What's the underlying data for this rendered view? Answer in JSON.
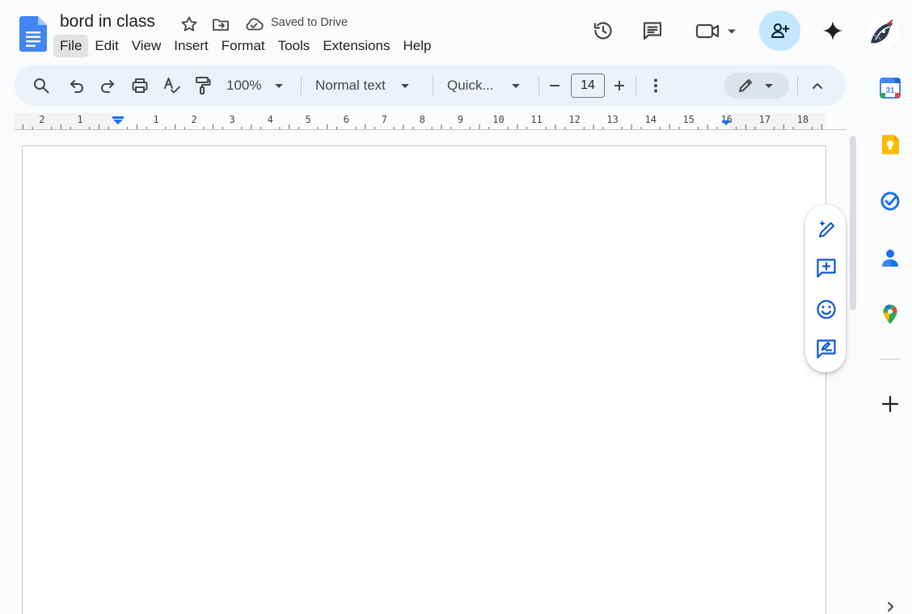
{
  "document": {
    "title": "bord in class",
    "save_status": "Saved to Drive"
  },
  "menu": [
    {
      "label": "File",
      "active": true
    },
    {
      "label": "Edit"
    },
    {
      "label": "View"
    },
    {
      "label": "Insert"
    },
    {
      "label": "Format"
    },
    {
      "label": "Tools"
    },
    {
      "label": "Extensions"
    },
    {
      "label": "Help"
    }
  ],
  "toolbar": {
    "zoom": "100%",
    "style": "Normal text",
    "font": "Quick...",
    "font_size": "14"
  },
  "ruler": {
    "left_labels": [
      "2",
      "1"
    ],
    "right_labels": [
      "1",
      "2",
      "3",
      "4",
      "5",
      "6",
      "7",
      "8",
      "9",
      "10",
      "11",
      "12",
      "13",
      "14",
      "15",
      "16",
      "17",
      "18"
    ]
  },
  "side_panel": {
    "calendar_day": "31"
  },
  "colors": {
    "accent": "#0b57d0",
    "share_bg": "#c2e7ff",
    "toolbar_bg": "#edf2fa",
    "docs_blue": "#4285f4"
  }
}
